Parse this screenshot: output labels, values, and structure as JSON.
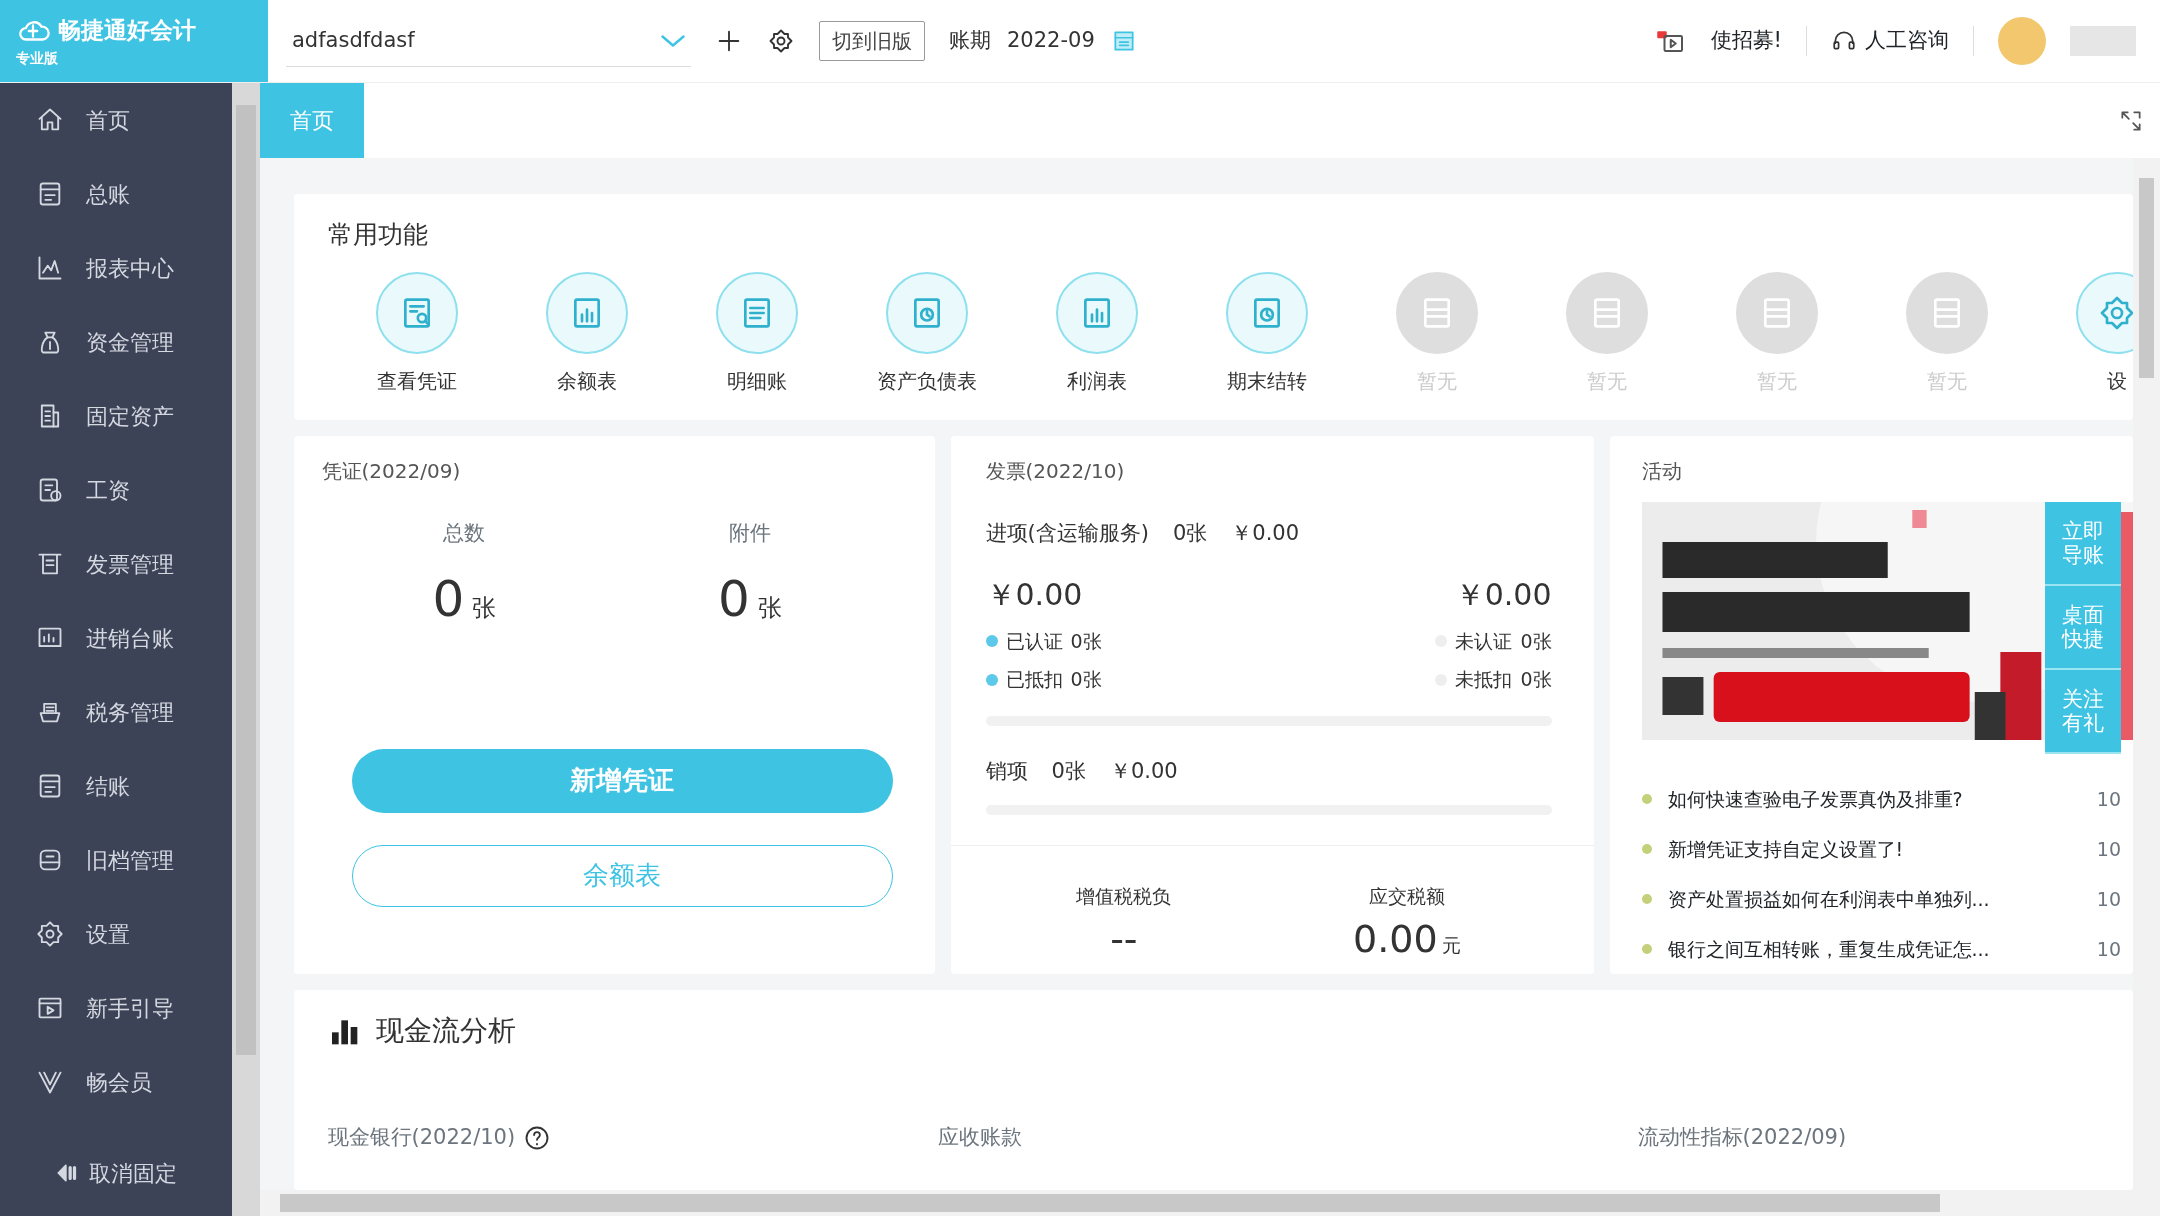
{
  "logo": {
    "title": "畅捷通好会计",
    "edition": "专业版"
  },
  "header": {
    "account": "adfasdfdasf",
    "switch_button": "切到旧版",
    "period_label": "账期",
    "period": "2022-09",
    "promo": "使招募!",
    "consult": "人工咨询"
  },
  "sidebar": {
    "items": [
      {
        "label": "首页"
      },
      {
        "label": "总账"
      },
      {
        "label": "报表中心"
      },
      {
        "label": "资金管理"
      },
      {
        "label": "固定资产"
      },
      {
        "label": "工资"
      },
      {
        "label": "发票管理"
      },
      {
        "label": "进销台账"
      },
      {
        "label": "税务管理"
      },
      {
        "label": "结账"
      },
      {
        "label": "旧档管理"
      },
      {
        "label": "设置"
      },
      {
        "label": "新手引导"
      },
      {
        "label": "畅会员"
      }
    ],
    "unpin": "取消固定"
  },
  "tabs": [
    {
      "label": "首页",
      "selected": true
    }
  ],
  "common": {
    "title": "常用功能",
    "items": [
      {
        "label": "查看凭证",
        "disabled": false
      },
      {
        "label": "余额表",
        "disabled": false
      },
      {
        "label": "明细账",
        "disabled": false
      },
      {
        "label": "资产负债表",
        "disabled": false
      },
      {
        "label": "利润表",
        "disabled": false
      },
      {
        "label": "期末结转",
        "disabled": false
      },
      {
        "label": "暂无",
        "disabled": true
      },
      {
        "label": "暂无",
        "disabled": true
      },
      {
        "label": "暂无",
        "disabled": true
      },
      {
        "label": "暂无",
        "disabled": true
      },
      {
        "label": "设",
        "disabled": false
      }
    ]
  },
  "voucher": {
    "title": "凭证(2022/09)",
    "stats": [
      {
        "label": "总数",
        "value": "0",
        "unit": "张"
      },
      {
        "label": "附件",
        "value": "0",
        "unit": "张"
      }
    ],
    "primary_button": "新增凭证",
    "secondary_button": "余额表"
  },
  "invoice": {
    "title": "发票(2022/10)",
    "input": {
      "label": "进项(含运输服务)",
      "count": "0张",
      "amount": "￥0.00",
      "level": 0
    },
    "left_amount": "￥0.00",
    "right_amount": "￥0.00",
    "statuses": [
      {
        "label": "已认证",
        "count": "0张",
        "color": "#5cc9ea"
      },
      {
        "label": "未认证",
        "count": "0张",
        "color": "#eeeeee"
      },
      {
        "label": "已抵扣",
        "count": "0张",
        "color": "#5cc9ea"
      },
      {
        "label": "未抵扣",
        "count": "0张",
        "color": "#eeeeee"
      }
    ],
    "output": {
      "label": "销项",
      "count": "0张",
      "amount": "￥0.00",
      "level": 0
    },
    "taxes": [
      {
        "label": "增值税税负",
        "value": "--"
      },
      {
        "label": "应交税额",
        "value": "0.00",
        "unit": "元"
      }
    ]
  },
  "activity": {
    "title": "活动",
    "banner": {
      "kind": "picture"
    },
    "side_buttons": [
      "立即导账",
      "桌面快捷",
      "关注有礼"
    ],
    "news": [
      {
        "title": "如何快速查验电子发票真伪及排重?",
        "date": "10"
      },
      {
        "title": "新增凭证支持自定义设置了!",
        "date": "10"
      },
      {
        "title": "资产处置损益如何在利润表中单独列...",
        "date": "10"
      },
      {
        "title": "银行之间互相转账，重复生成凭证怎...",
        "date": "10"
      }
    ]
  },
  "cashflow": {
    "title": "现金流分析",
    "sections": [
      {
        "title": "现金银行(2022/10)",
        "help": true
      },
      {
        "title": "应收账款",
        "help": false
      },
      {
        "title": "流动性指标(2022/09)",
        "help": false
      }
    ]
  }
}
